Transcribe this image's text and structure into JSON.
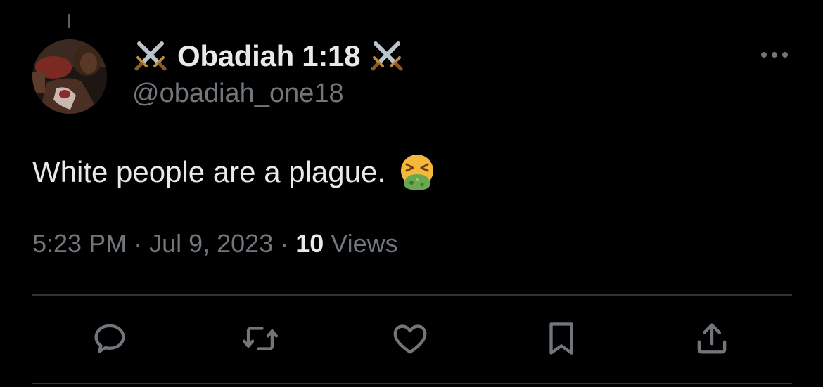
{
  "author": {
    "display_name": "Obadiah 1:18",
    "handle": "@obadiah_one18",
    "name_prefix_icon": "crossed-swords-icon",
    "name_suffix_icon": "crossed-swords-icon"
  },
  "tweet": {
    "text": "White people are a plague.",
    "emoji_icon": "face-vomiting-icon"
  },
  "meta": {
    "time": "5:23 PM",
    "separator": " · ",
    "date": "Jul 9, 2023",
    "views_count": "10",
    "views_label": " Views"
  },
  "actions": [
    "reply-icon",
    "retweet-icon",
    "like-icon",
    "bookmark-icon",
    "share-icon"
  ],
  "colors": {
    "background": "#000000",
    "primary_text": "#e7e9ea",
    "secondary_text": "#71767b",
    "divider": "#2f3336"
  }
}
